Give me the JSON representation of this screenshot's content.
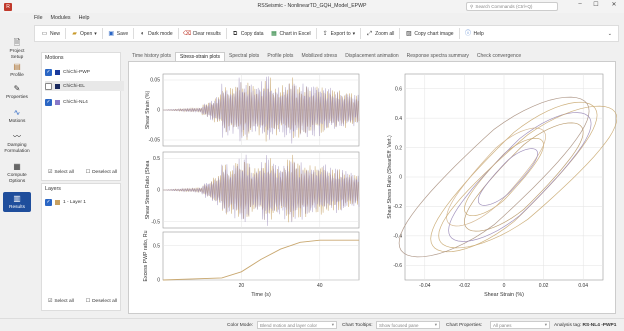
{
  "window": {
    "title": "RSSeismic - NonlinearTD_GQH_Model_EPWP",
    "search_placeholder": "Search Commands (Ctrl+Q)"
  },
  "menu": [
    "File",
    "Modules",
    "Help"
  ],
  "toolbar": {
    "new": "New",
    "open": "Open",
    "save": "Save",
    "dark": "Dark mode",
    "clear": "Clear results",
    "copy": "Copy data",
    "excel": "Chart in Excel",
    "export": "Export to",
    "zoom": "Zoom all",
    "copyimg": "Copy chart image",
    "help": "Help"
  },
  "nav": [
    {
      "label": "Project Setup",
      "icon": "document-icon"
    },
    {
      "label": "Profile",
      "icon": "profile-icon"
    },
    {
      "label": "Properties",
      "icon": "properties-icon"
    },
    {
      "label": "Motions",
      "icon": "motions-icon"
    },
    {
      "label": "Damping Formulation",
      "icon": "damping-icon"
    },
    {
      "label": "Compute Options",
      "icon": "compute-icon"
    },
    {
      "label": "Results",
      "icon": "results-icon"
    }
  ],
  "motions": {
    "title": "Motions",
    "items": [
      {
        "label": "ChiChi-PWP",
        "checked": true,
        "color": "#1a3a9c"
      },
      {
        "label": "ChiChi-EL",
        "checked": false,
        "color": "#1a2a5e"
      },
      {
        "label": "ChiChi-NL4",
        "checked": true,
        "color": "#8878c8"
      }
    ],
    "select_all": "Select all",
    "deselect_all": "Deselect all"
  },
  "layers": {
    "title": "Layers",
    "items": [
      {
        "label": "1 - Layer 1",
        "checked": true,
        "color": "#c8a060"
      }
    ],
    "select_all": "Select all",
    "deselect_all": "Deselect all"
  },
  "tabs": [
    "Time history plots",
    "Stress-strain plots",
    "Spectral plots",
    "Profile plots",
    "Mobilized stress",
    "Displacement animation",
    "Response spectra summary",
    "Check convergence"
  ],
  "active_tab": 1,
  "status": {
    "color_mode_label": "Color Mode:",
    "color_mode_value": "Blend motion and layer color",
    "tooltips_label": "Chart Tooltips:",
    "tooltips_value": "Show focused pane",
    "props_label": "Chart Properties:",
    "props_value": "All panes",
    "tag_label": "Analysis tag:",
    "tag_value": "RS-NL4 -PWP1"
  },
  "chart_data": [
    {
      "type": "line",
      "title": "",
      "xlabel": "",
      "ylabel": "Shear Strain (%)",
      "xlim": [
        0,
        50
      ],
      "ylim": [
        -0.06,
        0.06
      ],
      "yticks": [
        0.05,
        0,
        -0.05
      ],
      "series": [
        {
          "values_shape": "oscillation",
          "color": "#c9a870"
        },
        {
          "values_shape": "oscillation",
          "color": "#9a8ab8"
        }
      ]
    },
    {
      "type": "line",
      "title": "",
      "xlabel": "",
      "ylabel": "Shear Stress Ratio (Shea",
      "xlim": [
        0,
        50
      ],
      "ylim": [
        -0.6,
        0.6
      ],
      "yticks": [
        0.5,
        0,
        -0.5
      ],
      "series": [
        {
          "values_shape": "oscillation",
          "color": "#c9a870"
        },
        {
          "values_shape": "oscillation",
          "color": "#9a8ab8"
        }
      ]
    },
    {
      "type": "line",
      "title": "",
      "xlabel": "Time (s)",
      "ylabel": "Excess PWP ratio, Ru",
      "xlim": [
        0,
        50
      ],
      "ylim": [
        0,
        0.7
      ],
      "yticks": [
        0.5,
        0
      ],
      "xticks": [
        20,
        40
      ],
      "series": [
        {
          "x": [
            0,
            15,
            20,
            25,
            30,
            35,
            40,
            45,
            50
          ],
          "values": [
            0,
            0.03,
            0.12,
            0.3,
            0.45,
            0.55,
            0.58,
            0.58,
            0.58
          ],
          "color": "#c9a870"
        }
      ]
    },
    {
      "type": "scatter",
      "title": "",
      "xlabel": "Shear Strain (%)",
      "ylabel": "Shear Stress Ratio (Shear/Eff. Vert.)",
      "xlim": [
        -0.05,
        0.05
      ],
      "ylim": [
        -0.7,
        0.7
      ],
      "xticks": [
        -0.04,
        -0.02,
        0,
        0.02,
        0.04
      ],
      "yticks": [
        0.6,
        0.4,
        0.2,
        0,
        -0.2,
        -0.4,
        -0.6
      ],
      "series": [
        {
          "values_shape": "hysteresis-loops",
          "color": "#c9a870"
        }
      ]
    }
  ]
}
